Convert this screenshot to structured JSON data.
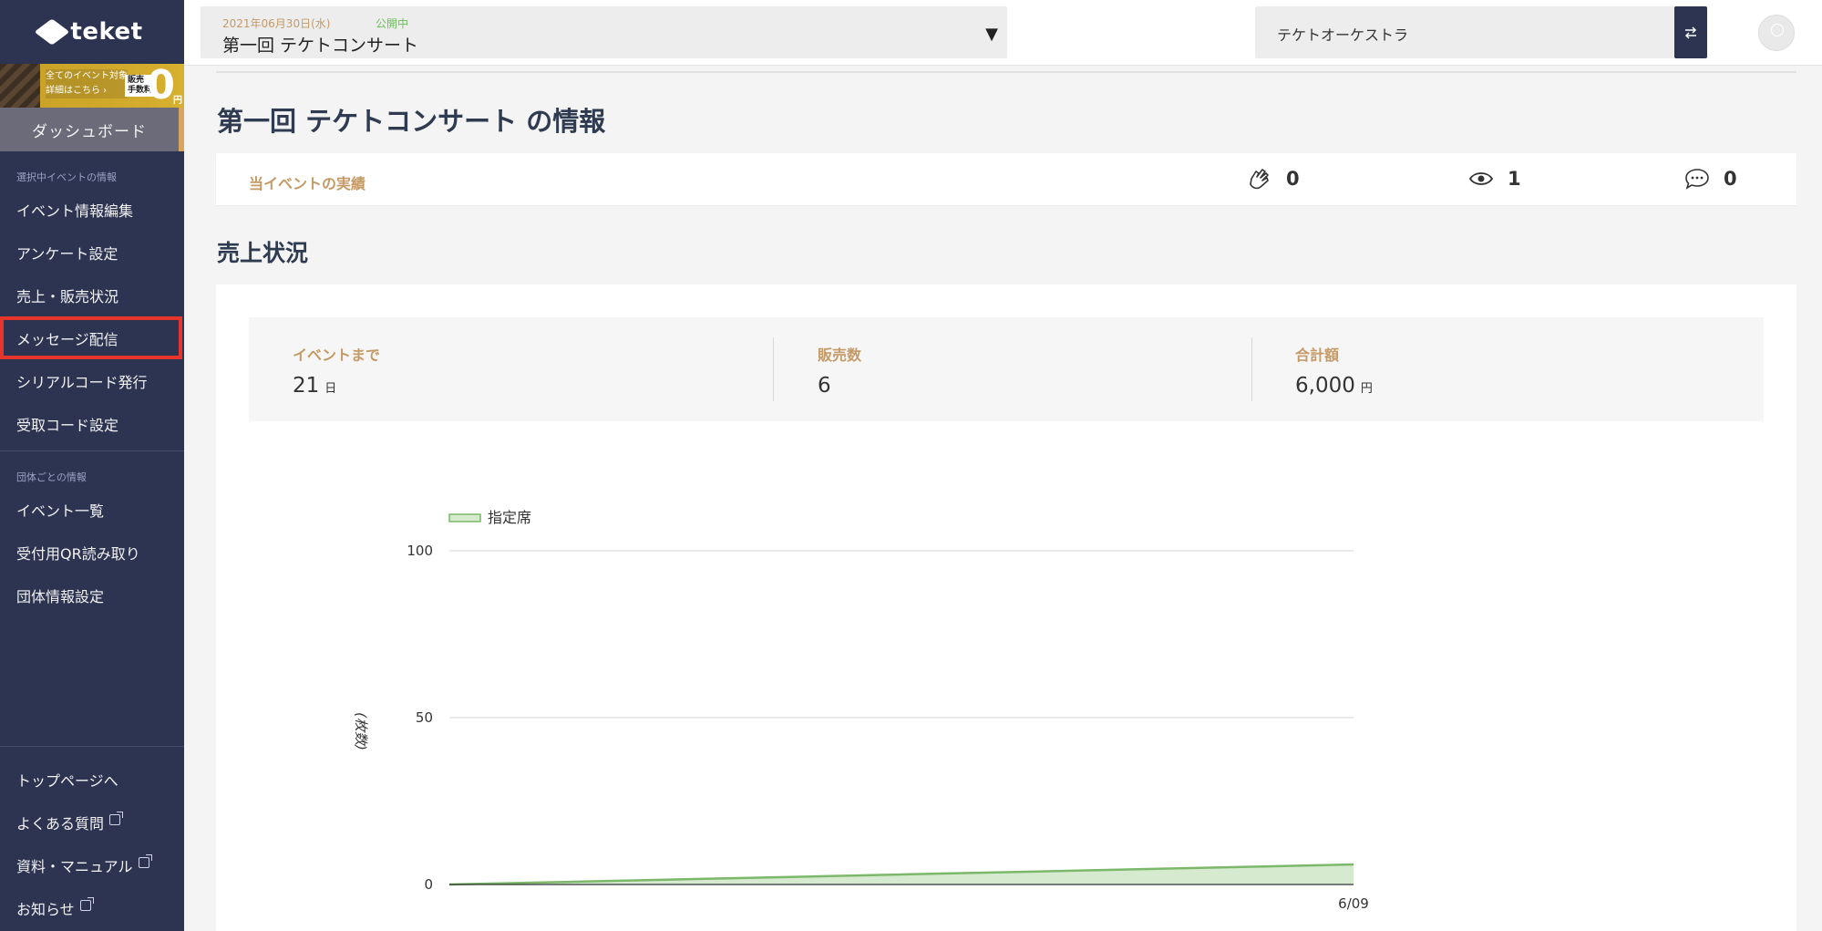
{
  "sidebar": {
    "logo_text": "teket",
    "banner": {
      "line1": "全てのイベント対象",
      "line2": "詳細はこちら ›",
      "tag_line1": "販売",
      "tag_line2": "手数料",
      "zero": "0",
      "yen": "円"
    },
    "dashboard_label": "ダッシュボード",
    "section1_title": "選択中イベントの情報",
    "section1_items": [
      "イベント情報編集",
      "アンケート設定",
      "売上・販売状況",
      "メッセージ配信",
      "シリアルコード発行",
      "受取コード設定"
    ],
    "section2_title": "団体ごとの情報",
    "section2_items": [
      "イベント一覧",
      "受付用QR読み取り",
      "団体情報設定"
    ],
    "bottom_items": [
      "トップページへ",
      "よくある質問",
      "資料・マニュアル",
      "お知らせ"
    ]
  },
  "header": {
    "event_date": "2021年06月30日(水)",
    "event_status": "公開中",
    "event_name": "第一回 テケトコンサート",
    "org_name": "テケトオーケストラ"
  },
  "main": {
    "page_title": "第一回 テケトコンサート の情報",
    "results_label": "当イベントの実績",
    "claps": "0",
    "views": "1",
    "comments": "0",
    "sales_title": "売上状況",
    "summary": {
      "days_label": "イベントまで",
      "days_value": "21",
      "days_unit": "日",
      "sold_label": "販売数",
      "sold_value": "6",
      "total_label": "合計額",
      "total_value": "6,000",
      "total_unit": "円"
    }
  },
  "colors": {
    "sidebar_bg": "#2d3452",
    "accent": "#c49a67",
    "highlight": "#e8352b",
    "status_green": "#6bbf5a",
    "series_green": "#7cb86a"
  },
  "chart_data": {
    "type": "area",
    "series": [
      {
        "name": "指定席",
        "x": [
          "",
          "6/09"
        ],
        "values": [
          0,
          6
        ]
      }
    ],
    "ylabel": "(枚数)",
    "ylim": [
      0,
      100
    ],
    "yticks": [
      0,
      50,
      100
    ],
    "xtick_labels": [
      "6/09"
    ],
    "legend_position": "top-left",
    "grid": true
  }
}
